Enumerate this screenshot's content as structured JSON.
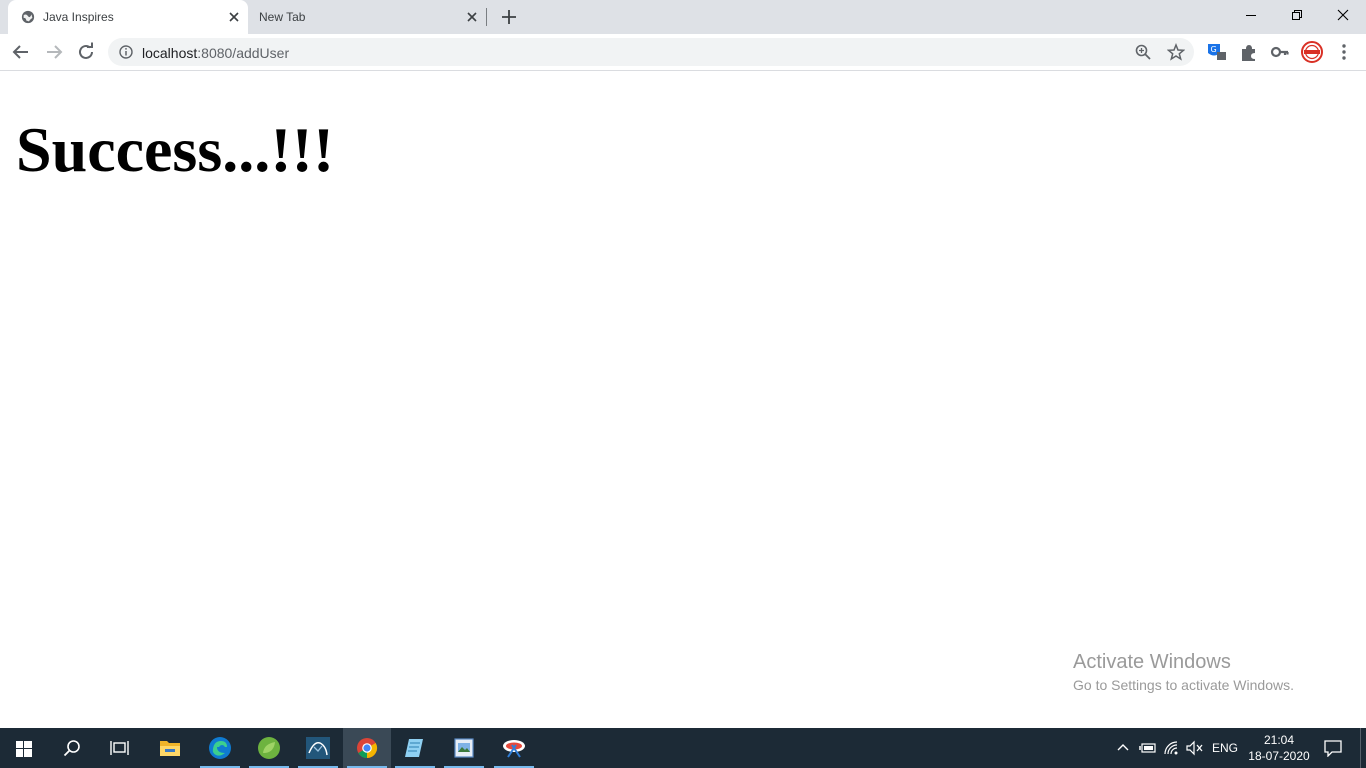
{
  "browser": {
    "tabs": [
      {
        "title": "Java Inspires",
        "active": true
      },
      {
        "title": "New Tab",
        "active": false
      }
    ],
    "url": {
      "host": "localhost",
      "rest": ":8080/addUser"
    }
  },
  "page": {
    "message": "Success...!!!"
  },
  "watermark": {
    "line1": "Activate Windows",
    "line2": "Go to Settings to activate Windows."
  },
  "taskbar": {
    "language": "ENG",
    "time": "21:04",
    "date": "18-07-2020"
  },
  "colors": {
    "tabstrip": "#dee1e6",
    "taskbar": "#1c2a36",
    "taskbar_underline": "#76b9ed"
  }
}
